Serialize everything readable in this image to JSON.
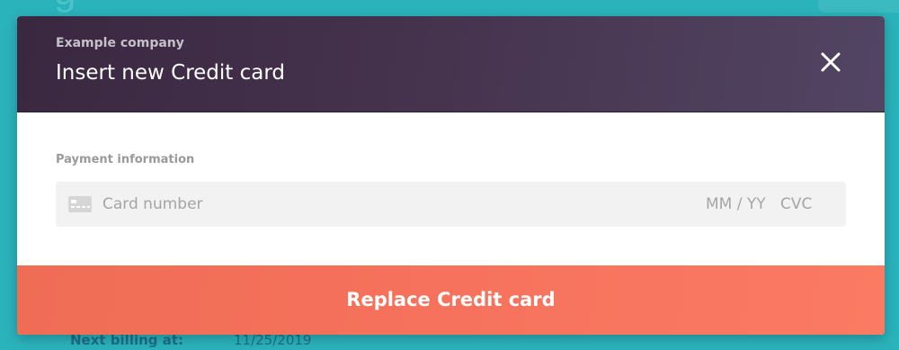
{
  "modal": {
    "company": "Example company",
    "title": "Insert new Credit card",
    "section_label": "Payment information",
    "card_number_placeholder": "Card number",
    "expiry_placeholder": "MM / YY",
    "cvc_placeholder": "CVC",
    "submit_label": "Replace Credit card",
    "close_icon": "close-icon",
    "card_icon": "credit-card-icon"
  },
  "background": {
    "heading_fragment": "g",
    "billing_label": "Next billing at:",
    "billing_value": "11/25/2019"
  },
  "colors": {
    "header_gradient_start": "#3a2740",
    "header_gradient_end": "#524563",
    "accent": "#f6725c",
    "page_background": "#2bb3bc"
  }
}
